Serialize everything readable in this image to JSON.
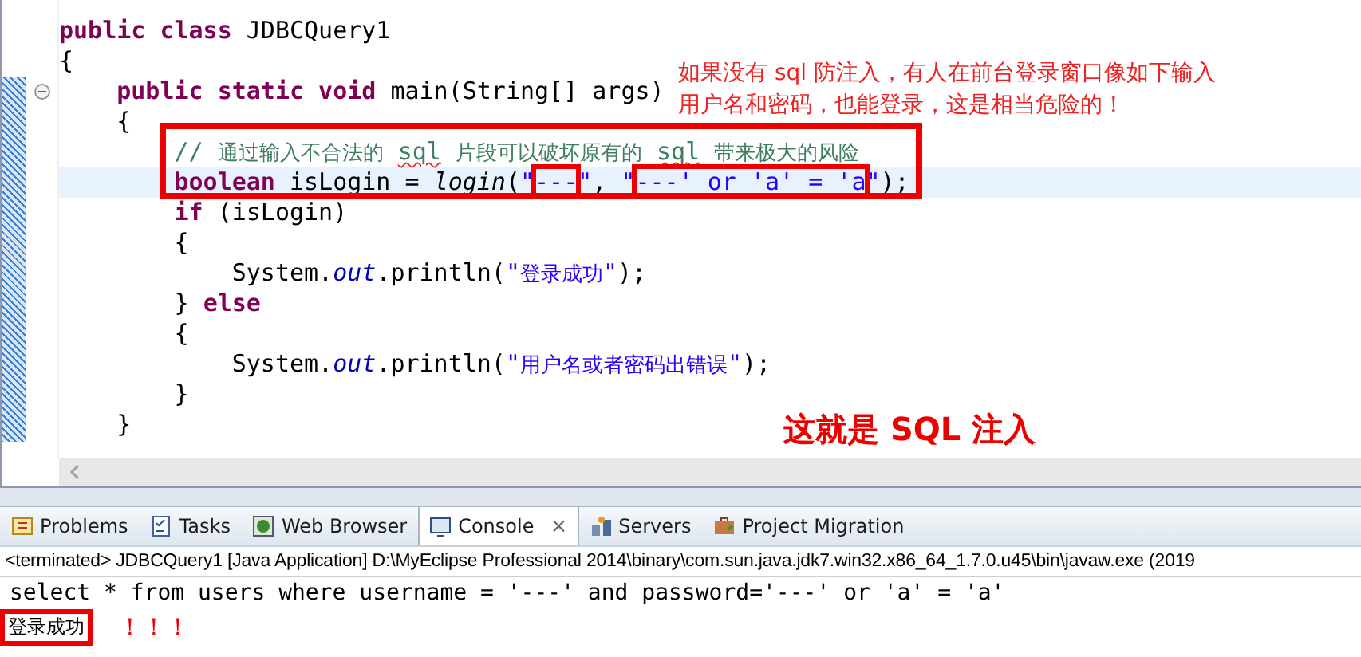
{
  "editor": {
    "lines": [
      {
        "tokens": [
          {
            "kind": "keyword",
            "text": "public class"
          },
          {
            "kind": "plain",
            "text": " JDBCQuery1"
          }
        ]
      },
      {
        "tokens": [
          {
            "kind": "plain",
            "text": "{"
          }
        ]
      },
      {
        "expanded": true,
        "tokens": [
          {
            "kind": "keyword",
            "text": "    public static void"
          },
          {
            "kind": "plain",
            "text": " main(String[] args)"
          }
        ]
      },
      {
        "tokens": [
          {
            "kind": "plain",
            "text": "    {"
          }
        ]
      },
      {
        "boxed": true,
        "tokens": [
          {
            "kind": "comment",
            "text": "        // 通过输入不合法的 "
          },
          {
            "kind": "comment",
            "text": "sql",
            "misspelled": true
          },
          {
            "kind": "comment",
            "text": " 片段可以破坏原有的 "
          },
          {
            "kind": "comment",
            "text": "sql",
            "misspelled": true
          },
          {
            "kind": "comment",
            "text": " 带来极大的风险"
          }
        ]
      },
      {
        "boxed": true,
        "current": true,
        "tokens": [
          {
            "kind": "keyword",
            "text": "        boolean"
          },
          {
            "kind": "plain",
            "text": " isLogin = "
          },
          {
            "kind": "method",
            "text": "login"
          },
          {
            "kind": "plain",
            "text": "("
          },
          {
            "kind": "string",
            "text": "\""
          },
          {
            "kind": "string",
            "text": "---",
            "boxed": true
          },
          {
            "kind": "string",
            "text": "\""
          },
          {
            "kind": "plain",
            "text": ", "
          },
          {
            "kind": "string",
            "text": "\""
          },
          {
            "kind": "string",
            "text": "---' or 'a' = 'a",
            "boxed": true
          },
          {
            "kind": "string",
            "text": "\""
          },
          {
            "kind": "plain",
            "text": ");"
          }
        ]
      },
      {
        "tokens": [
          {
            "kind": "keyword",
            "text": "        if"
          },
          {
            "kind": "plain",
            "text": " (isLogin)"
          }
        ]
      },
      {
        "tokens": [
          {
            "kind": "plain",
            "text": "        {"
          }
        ]
      },
      {
        "tokens": [
          {
            "kind": "plain",
            "text": "            System."
          },
          {
            "kind": "field",
            "text": "out"
          },
          {
            "kind": "plain",
            "text": ".println("
          },
          {
            "kind": "string",
            "text": "\"登录成功\""
          },
          {
            "kind": "plain",
            "text": ");"
          }
        ]
      },
      {
        "tokens": [
          {
            "kind": "plain",
            "text": "        } "
          },
          {
            "kind": "keyword",
            "text": "else"
          }
        ]
      },
      {
        "tokens": [
          {
            "kind": "plain",
            "text": "        {"
          }
        ]
      },
      {
        "tokens": [
          {
            "kind": "plain",
            "text": "            System."
          },
          {
            "kind": "field",
            "text": "out"
          },
          {
            "kind": "plain",
            "text": ".println("
          },
          {
            "kind": "string",
            "text": "\"用户名或者密码出错误\""
          },
          {
            "kind": "plain",
            "text": ");"
          }
        ]
      },
      {
        "tokens": [
          {
            "kind": "plain",
            "text": "        }"
          }
        ]
      },
      {
        "tokens": [
          {
            "kind": "plain",
            "text": "    }"
          }
        ]
      }
    ],
    "note": [
      "如果没有 sql 防注入，有人在前台登录窗口像如下输入",
      "用户名和密码，也能登录，这是相当危险的！"
    ],
    "headline": "这就是 SQL 注入"
  },
  "panel": {
    "tabs": [
      {
        "label": "Problems",
        "selected": false
      },
      {
        "label": "Tasks",
        "selected": false
      },
      {
        "label": "Web Browser",
        "selected": false
      },
      {
        "label": "Console",
        "selected": true,
        "close": "×"
      },
      {
        "label": "Servers",
        "selected": false
      },
      {
        "label": "Project Migration",
        "selected": false
      }
    ],
    "header": "<terminated> JDBCQuery1 [Java Application] D:\\MyEclipse Professional 2014\\binary\\com.sun.java.jdk7.win32.x86_64_1.7.0.u45\\bin\\javaw.exe (2019",
    "output": [
      {
        "text": "select * from users where username = '---' and password='---' or 'a' = 'a'"
      },
      {
        "text": "登录成功",
        "boxed": true,
        "note": "！！！"
      }
    ]
  }
}
